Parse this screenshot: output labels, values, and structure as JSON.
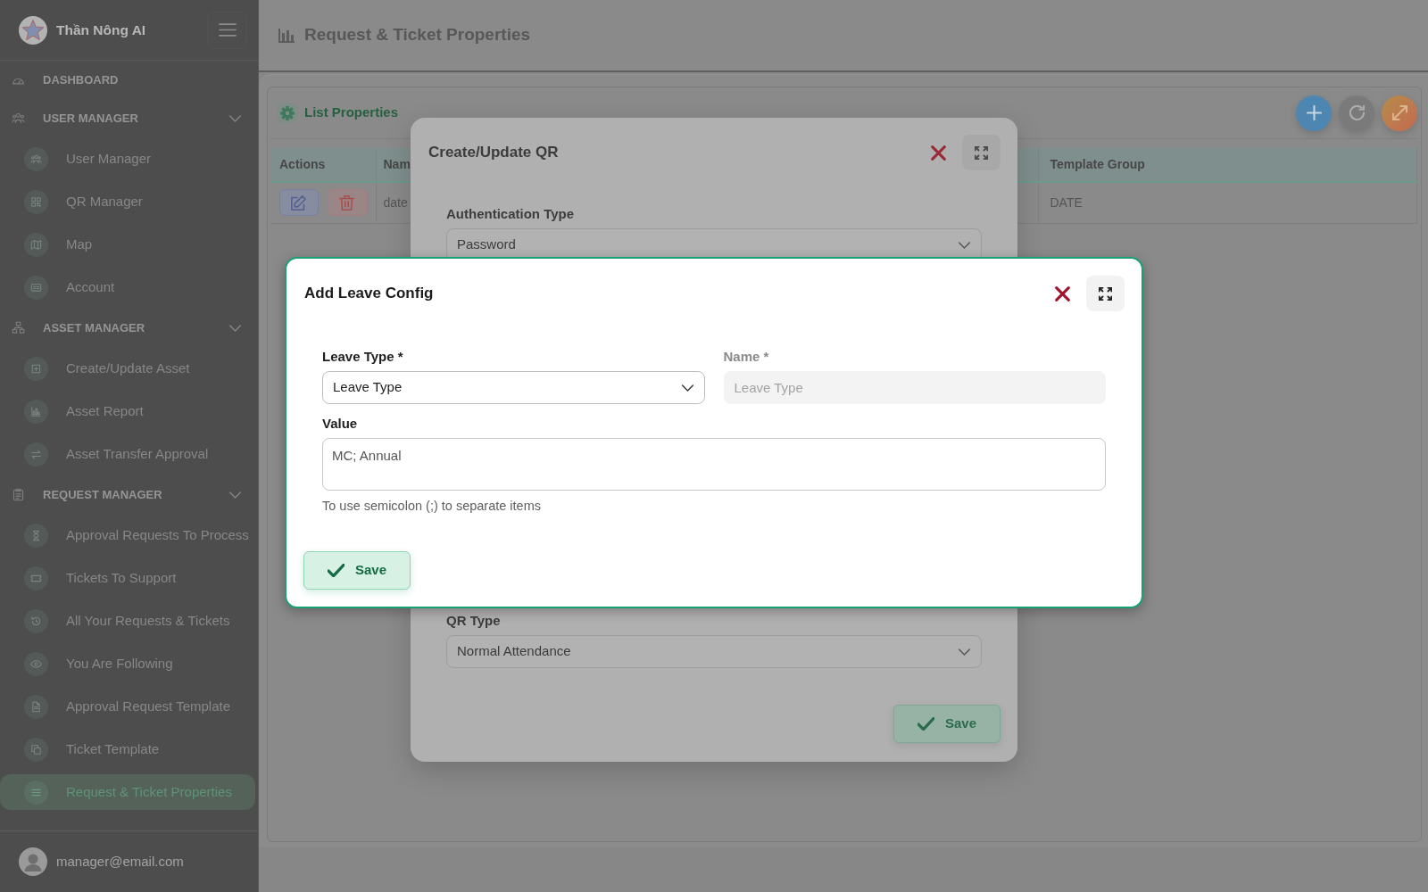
{
  "sidebar": {
    "brand": "Thần Nông AI",
    "groups": [
      {
        "kind": "link",
        "label": "DASHBOARD",
        "selected": false
      },
      {
        "kind": "group",
        "label": "USER MANAGER",
        "expanded": true,
        "items": [
          {
            "label": "User Manager",
            "selected": false
          },
          {
            "label": "QR Manager",
            "selected": false
          },
          {
            "label": "Map",
            "selected": false
          },
          {
            "label": "Account",
            "selected": false
          }
        ]
      },
      {
        "kind": "group",
        "label": "ASSET MANAGER",
        "expanded": true,
        "items": [
          {
            "label": "Create/Update Asset",
            "selected": false
          },
          {
            "label": "Asset Report",
            "selected": false
          },
          {
            "label": "Asset Transfer Approval",
            "selected": false
          }
        ]
      },
      {
        "kind": "group",
        "label": "REQUEST MANAGER",
        "expanded": true,
        "items": [
          {
            "label": "Approval Requests To Process",
            "selected": false
          },
          {
            "label": "Tickets To Support",
            "selected": false
          },
          {
            "label": "All Your Requests & Tickets",
            "selected": false
          },
          {
            "label": "You Are Following",
            "selected": false
          },
          {
            "label": "Approval Request Template",
            "selected": false
          },
          {
            "label": "Ticket Template",
            "selected": false
          },
          {
            "label": "Request & Ticket Properties",
            "selected": true
          }
        ]
      }
    ],
    "user_email": "manager@email.com"
  },
  "header": {
    "title": "Request & Ticket Properties"
  },
  "card": {
    "title": "List Properties",
    "table": {
      "columns": [
        "Actions",
        "Nam",
        "Template Group"
      ],
      "rows": [
        {
          "cells": [
            "",
            "date",
            "DATE"
          ]
        }
      ]
    }
  },
  "dialogs": [
    {
      "title": "Create/Update QR",
      "rows": [
        {
          "fields": [
            {
              "kind": "select",
              "label": "Authentication Type",
              "value": "Password",
              "disabled": false
            }
          ]
        },
        {
          "fields": [
            {
              "kind": "select",
              "label": "QR Type",
              "value": "Normal Attendance",
              "disabled": false
            }
          ]
        }
      ],
      "save": "Save"
    },
    {
      "title": "Add Leave Config",
      "rows": [
        {
          "fields": [
            {
              "kind": "select",
              "label": "Leave Type *",
              "value": "Leave Type",
              "disabled": false
            },
            {
              "kind": "input",
              "label": "Name *",
              "placeholder": "Leave Type",
              "disabled": true
            }
          ]
        },
        {
          "fields": [
            {
              "kind": "textarea",
              "label": "Value",
              "value": "MC; Annual",
              "help": "To use semicolon (;) to separate items",
              "disabled": false
            }
          ]
        }
      ],
      "save": "Save"
    }
  ]
}
